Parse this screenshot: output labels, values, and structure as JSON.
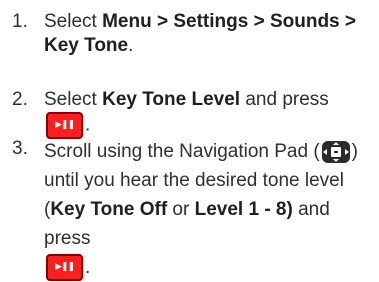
{
  "steps": [
    {
      "number": "1.",
      "text_before": "Select ",
      "bold": "Menu > Settings > Sounds > Key Tone",
      "text_after": "."
    },
    {
      "number": "2.",
      "text_before": "Select ",
      "bold": "Key Tone Level",
      "text_after": " and press",
      "icon": "play-pause-icon",
      "text_end": "."
    },
    {
      "number": "3.",
      "text_a": "Scroll using the Navigation Pad (",
      "icon_nav": "navigation-pad-icon",
      "text_b": ")",
      "text_c": "until you hear the desired tone level",
      "text_d": "(",
      "bold_d": "Key Tone Off",
      "text_e": " or ",
      "bold_e": "Level 1 - 8)",
      "text_f": " and press",
      "icon": "play-pause-icon",
      "text_end": "."
    }
  ],
  "colors": {
    "button_red": "#ff1f1f",
    "button_border": "#7e0000",
    "navpad_dark": "#2b2b2b"
  }
}
